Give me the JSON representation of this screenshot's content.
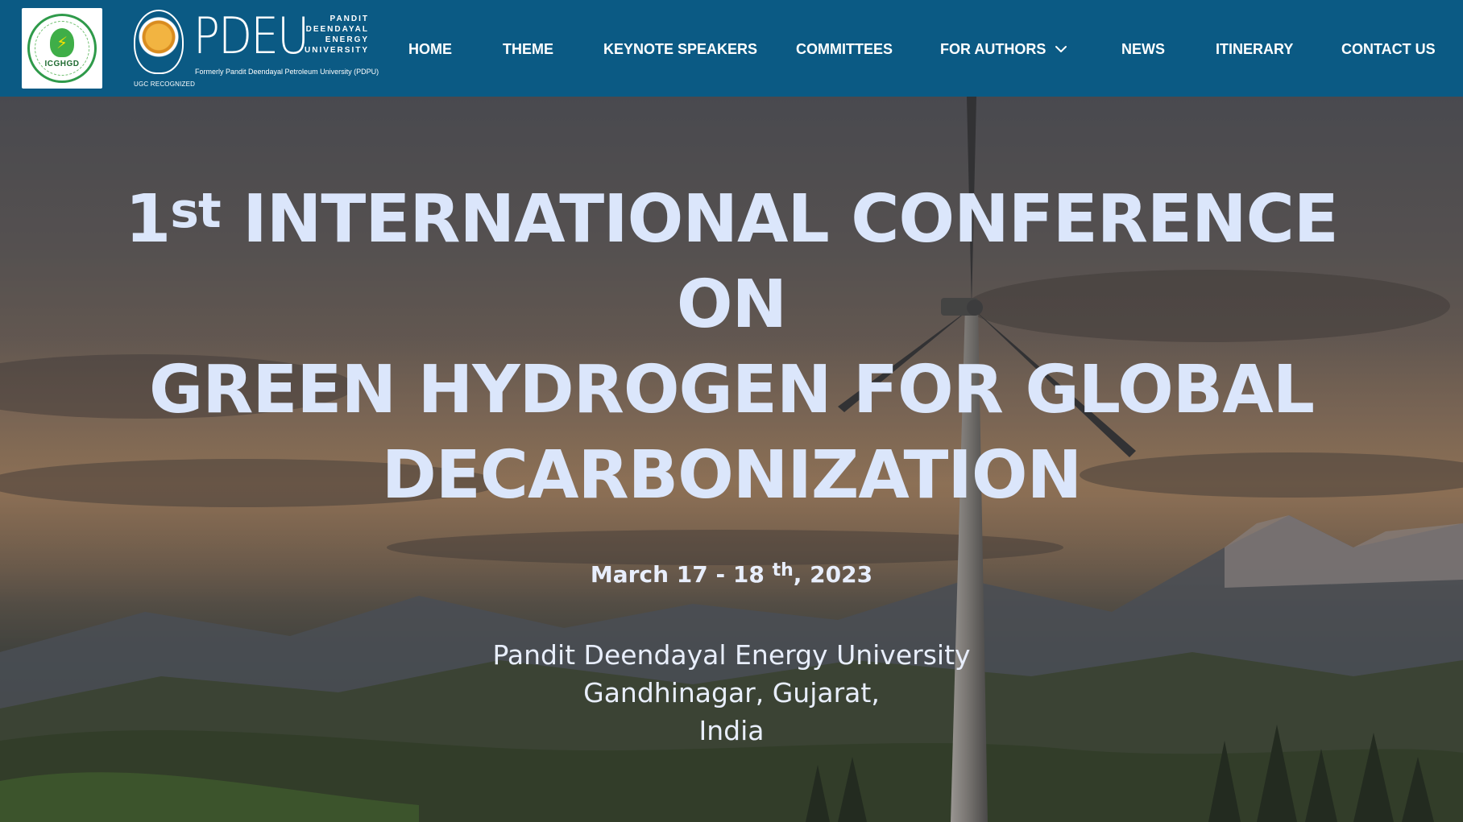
{
  "header": {
    "logo_icghgd": {
      "abbr": "ICGHGD",
      "ring_text": "1ST INTERNATIONAL CONFERENCE ON GREEN HYDROGEN FOR GLOBAL DECARBONIZATION"
    },
    "logo_pdeu": {
      "wordmark": "PDEU",
      "side_lines": [
        "PANDIT",
        "DEENDAYAL",
        "ENERGY",
        "UNIVERSITY"
      ],
      "formerly": "Formerly Pandit Deendayal Petroleum University (PDPU)",
      "recognition": "UGC RECOGNIZED"
    },
    "nav": {
      "home": "HOME",
      "theme": "THEME",
      "keynote": "KEYNOTE SPEAKERS",
      "committees": "COMMITTEES",
      "for_authors": "FOR AUTHORS",
      "news": "NEWS",
      "itinerary": "ITINERARY",
      "contact": "CONTACT US"
    },
    "colors": {
      "navbar_bg": "#0b5a84",
      "nav_text": "#ffffff"
    }
  },
  "hero": {
    "ordinal_number": "1",
    "ordinal_suffix": "st",
    "line1_rest": " INTERNATIONAL CONFERENCE",
    "line2": "ON",
    "line3": "GREEN HYDROGEN FOR GLOBAL",
    "line4": "DECARBONIZATION",
    "date_start": "March 17 - 18",
    "date_suffix": "th",
    "date_end": ", 2023",
    "venue_lines": [
      "Pandit Deendayal Energy University",
      "Gandhinagar, Gujarat,",
      "India"
    ],
    "colors": {
      "headline": "#dbe6fb",
      "subtext": "#e8eefc"
    }
  }
}
